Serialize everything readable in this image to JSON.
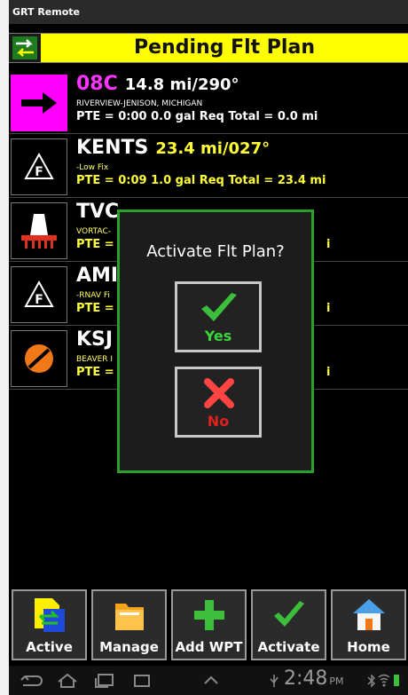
{
  "titlebar": {
    "app_title": "GRT Remote"
  },
  "header": {
    "title": "Pending Flt Plan"
  },
  "waypoints": [
    {
      "id": "08C",
      "dist": "14.8 mi/290°",
      "sub": "RIVERVIEW-JENISON, MICHIGAN",
      "pte": "PTE = 0:00   0.0 gal Req    Total = 0.0 mi",
      "icon": "arrow-right-icon"
    },
    {
      "id": "KENTS",
      "dist": "23.4 mi/027°",
      "sub": "-Low Fix",
      "pte": "PTE = 0:09   1.0 gal Req    Total = 23.4 mi",
      "icon": "fix-triangle-icon"
    },
    {
      "id": "TVC",
      "dist": "",
      "sub": "VORTAC-",
      "pte": "PTE = (",
      "icon": "vortac-icon"
    },
    {
      "id": "AMI",
      "dist": "",
      "sub": "-RNAV Fi",
      "pte": "PTE = ",
      "icon": "fix-triangle-icon"
    },
    {
      "id": "KSJ",
      "dist": "",
      "sub": "BEAVER I",
      "pte": "PTE = ",
      "icon": "airport-icon"
    }
  ],
  "dialog": {
    "question": "Activate Flt Plan?",
    "yes_label": "Yes",
    "no_label": "No"
  },
  "bottom_bar": {
    "active": "Active",
    "manage": "Manage",
    "add_wpt": "Add WPT",
    "activate": "Activate",
    "home": "Home"
  },
  "navbar": {
    "time": "2:48",
    "ampm": "PM"
  },
  "colors": {
    "header": "#ffff00",
    "magenta": "#ff00ff",
    "dialog_border": "#2aa02a",
    "yellow_text": "#ffff66"
  }
}
